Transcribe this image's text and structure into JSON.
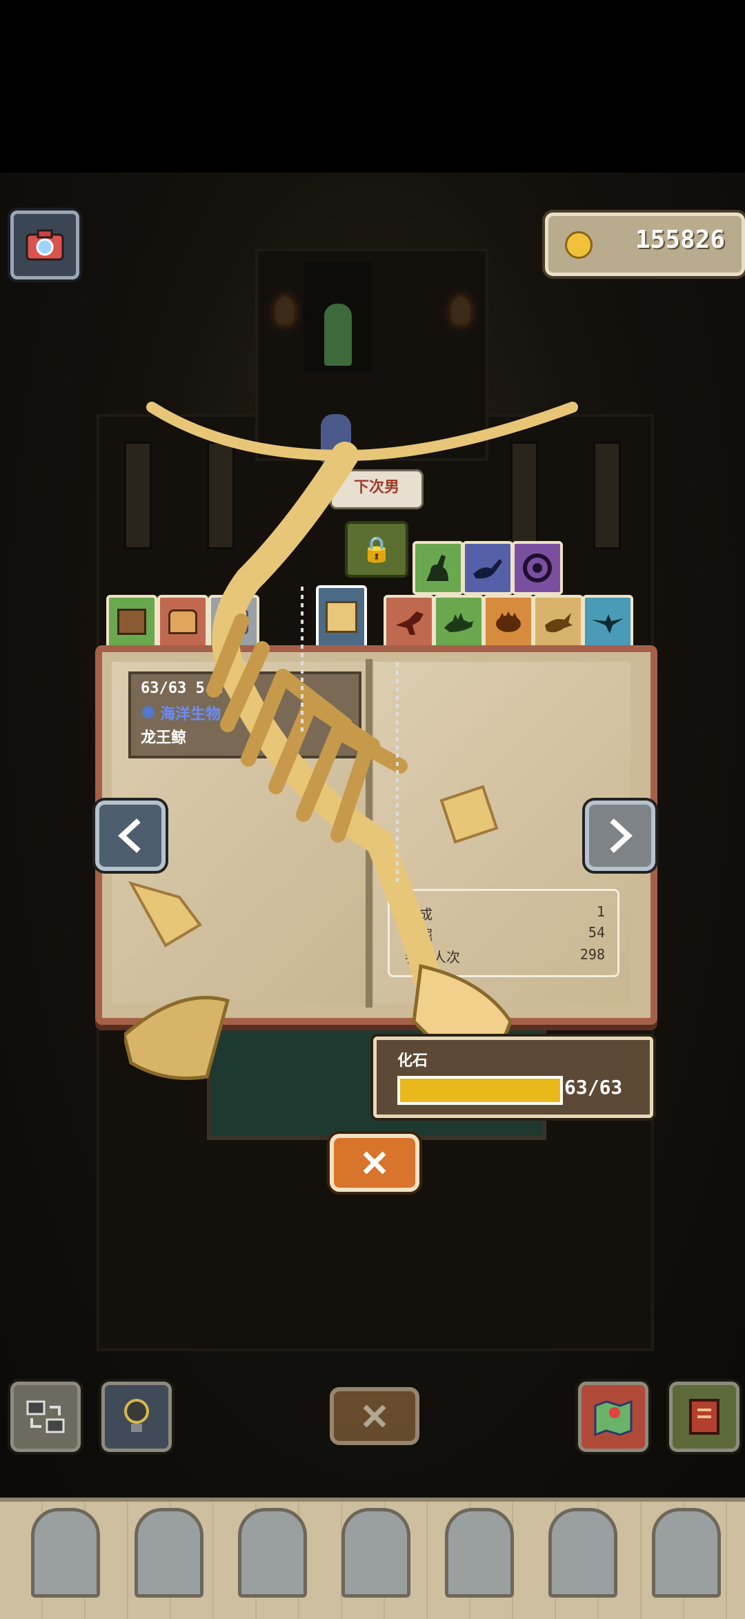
{
  "coins": "155826",
  "top_tag": "下次男",
  "fossil_info": {
    "progress_header": "63/63  5-2",
    "category": "海洋生物",
    "name": "龙王鲸"
  },
  "stats": [
    {
      "label": "完成",
      "value": "1"
    },
    {
      "label": "挖掘",
      "value": "54"
    },
    {
      "label": "参观人次",
      "value": "298"
    }
  ],
  "fossil_progress": {
    "label": "化石",
    "text": "63/63",
    "fraction": 1.0
  },
  "icons": {
    "camera": "camera-icon",
    "coin": "coin-icon",
    "close": "close-icon",
    "prev": "chevron-left-icon",
    "next": "chevron-right-icon",
    "lock": "lock-icon",
    "swap": "swap-icon",
    "hint": "lightbulb-icon",
    "map": "map-icon",
    "book": "book-icon"
  },
  "colors": {
    "tab_green": "#6aa84f",
    "tab_red": "#c1694f",
    "tab_gray": "#9aa0a6",
    "tab_blue": "#5560a8",
    "tab_purple": "#7b4fa0",
    "tab_orange": "#d78b3d",
    "tab_sand": "#d9b36b",
    "tab_teal": "#4a9bb8",
    "book_border": "#a46049"
  }
}
